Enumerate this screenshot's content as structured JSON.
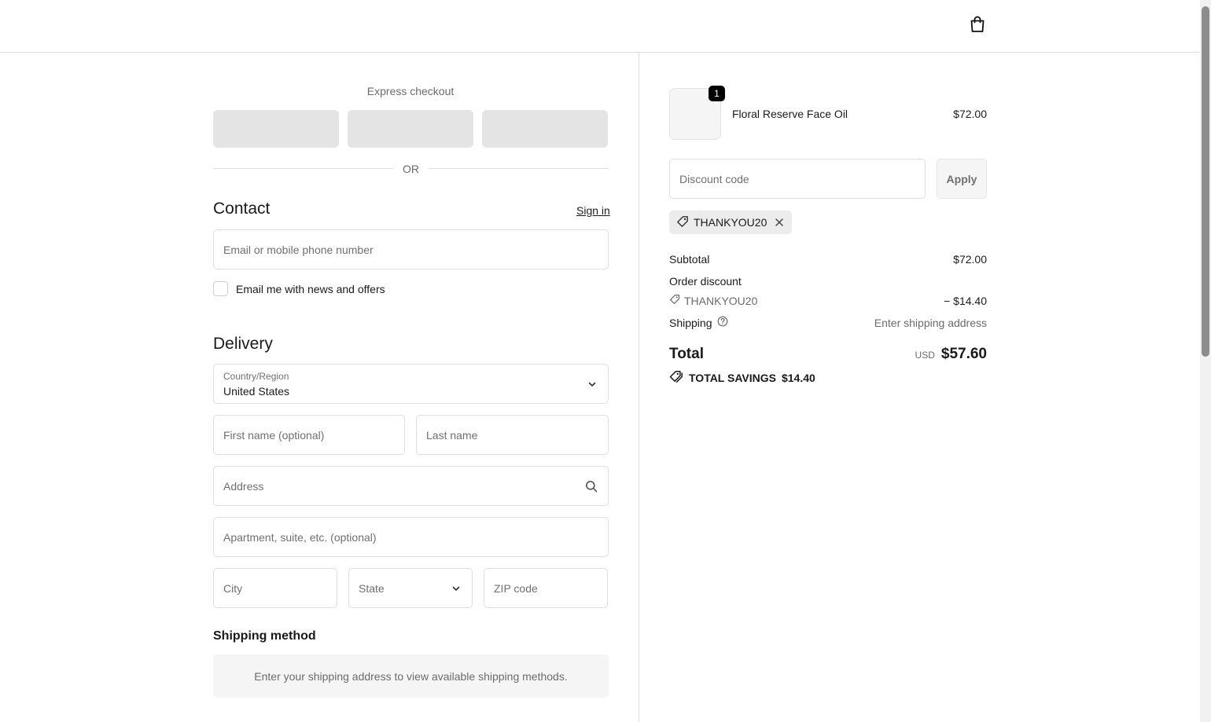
{
  "header": {
    "cart_icon": "shopping-bag-icon"
  },
  "express": {
    "label": "Express checkout",
    "or_text": "OR"
  },
  "contact": {
    "title": "Contact",
    "sign_in": "Sign in",
    "email_placeholder": "Email or mobile phone number",
    "news_checkbox_label": "Email me with news and offers"
  },
  "delivery": {
    "title": "Delivery",
    "country_label": "Country/Region",
    "country_value": "United States",
    "first_name_placeholder": "First name (optional)",
    "last_name_placeholder": "Last name",
    "address_placeholder": "Address",
    "apartment_placeholder": "Apartment, suite, etc. (optional)",
    "city_placeholder": "City",
    "state_placeholder": "State",
    "zip_placeholder": "ZIP code"
  },
  "shipping_method": {
    "title": "Shipping method",
    "message": "Enter your shipping address to view available shipping methods."
  },
  "order": {
    "product": {
      "name": "Floral Reserve Face Oil",
      "price": "$72.00",
      "quantity": "1"
    },
    "discount_placeholder": "Discount code",
    "apply_label": "Apply",
    "applied_code": "THANKYOU20",
    "subtotal_label": "Subtotal",
    "subtotal_value": "$72.00",
    "order_discount_label": "Order discount",
    "discount_code": "THANKYOU20",
    "discount_value": "− $14.40",
    "shipping_label": "Shipping",
    "shipping_value": "Enter shipping address",
    "total_label": "Total",
    "currency": "USD",
    "total_value": "$57.60",
    "savings_label": "TOTAL SAVINGS",
    "savings_value": "$14.40"
  }
}
